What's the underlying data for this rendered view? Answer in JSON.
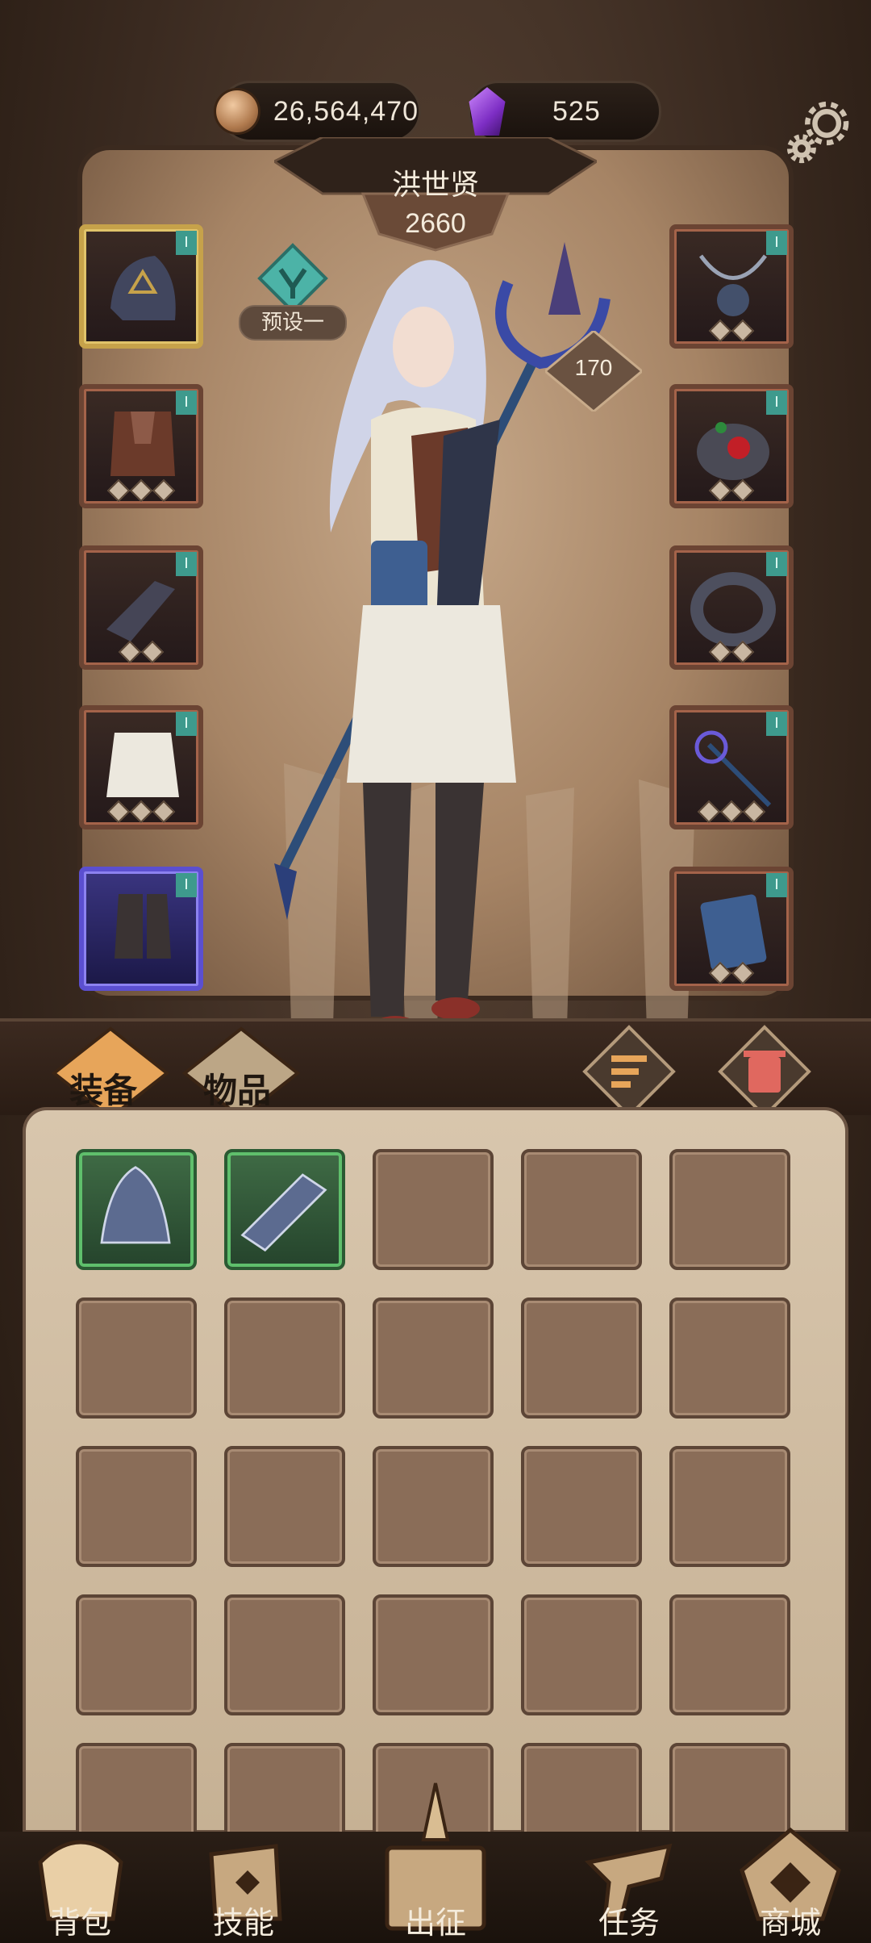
{
  "currency": {
    "coins": "26,564,470",
    "crystals": "525"
  },
  "character": {
    "name": "洪世贤",
    "power": "2660",
    "preset_label": "预设一",
    "level": "170"
  },
  "equipment": {
    "left": [
      {
        "name": "helmet",
        "tag": "I",
        "rarity": "gold",
        "gems": 0
      },
      {
        "name": "chest",
        "tag": "I",
        "rarity": "bronze",
        "gems": 3
      },
      {
        "name": "gloves",
        "tag": "I",
        "rarity": "bronze",
        "gems": 2
      },
      {
        "name": "pants",
        "tag": "I",
        "rarity": "bronze",
        "gems": 3
      },
      {
        "name": "boots",
        "tag": "I",
        "rarity": "purple",
        "gems": 0
      }
    ],
    "right": [
      {
        "name": "necklace",
        "tag": "I",
        "rarity": "bronze",
        "gems": 2
      },
      {
        "name": "ring",
        "tag": "I",
        "rarity": "bronze",
        "gems": 2
      },
      {
        "name": "bracelet",
        "tag": "I",
        "rarity": "bronze",
        "gems": 2
      },
      {
        "name": "staff",
        "tag": "I",
        "rarity": "bronze",
        "gems": 3
      },
      {
        "name": "tome",
        "tag": "I",
        "rarity": "bronze",
        "gems": 2
      }
    ]
  },
  "tabs": {
    "equipment": "装备",
    "items": "物品"
  },
  "inventory": {
    "rows": 5,
    "cols": 5,
    "filled": [
      "spiked-helm",
      "scale-gauntlet"
    ]
  },
  "nav": {
    "bag": "背包",
    "skills": "技能",
    "expedition": "出征",
    "quests": "任务",
    "shop": "商城"
  },
  "colors": {
    "accent_teal": "#3e9a8d",
    "green_rarity": "#5fbf6c",
    "purple_rarity": "#5b4fd0",
    "gold_rarity": "#c6a24a"
  }
}
